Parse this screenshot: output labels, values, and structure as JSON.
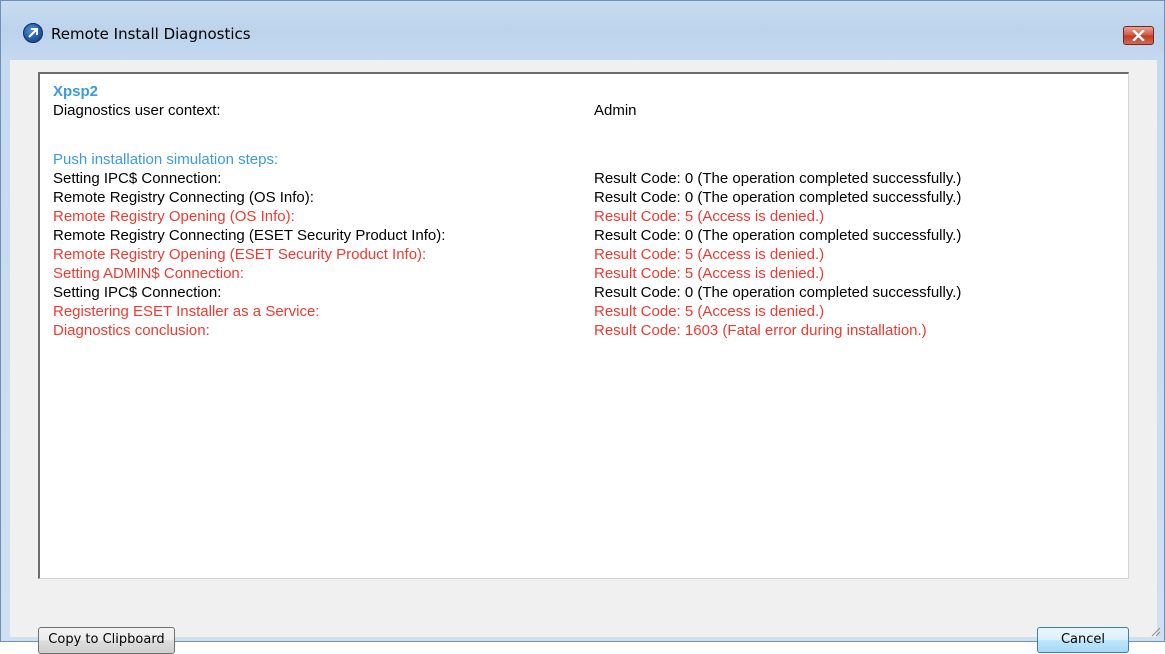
{
  "window": {
    "title": "Remote Install Diagnostics"
  },
  "log": {
    "host": "Xpsp2",
    "context_label": "Diagnostics user context:",
    "context_value": "Admin",
    "steps_heading": "Push installation simulation steps:",
    "steps": [
      {
        "label": "Setting IPC$ Connection:",
        "result": "Result Code: 0 (The operation completed successfully.)",
        "status": "ok"
      },
      {
        "label": "Remote Registry Connecting (OS Info):",
        "result": "Result Code: 0 (The operation completed successfully.)",
        "status": "ok"
      },
      {
        "label": "Remote Registry Opening (OS Info):",
        "result": "Result Code: 5 (Access is denied.)",
        "status": "error"
      },
      {
        "label": "Remote Registry Connecting (ESET Security Product Info):",
        "result": "Result Code: 0 (The operation completed successfully.)",
        "status": "ok"
      },
      {
        "label": "Remote Registry Opening (ESET Security Product Info):",
        "result": "Result Code: 5 (Access is denied.)",
        "status": "error"
      },
      {
        "label": "Setting ADMIN$ Connection:",
        "result": "Result Code: 5 (Access is denied.)",
        "status": "error"
      },
      {
        "label": "Setting IPC$ Connection:",
        "result": "Result Code: 0 (The operation completed successfully.)",
        "status": "ok"
      },
      {
        "label": "Registering ESET Installer as a Service:",
        "result": "Result Code: 5 (Access is denied.)",
        "status": "error"
      },
      {
        "label": "Diagnostics conclusion:",
        "result": "Result Code: 1603 (Fatal error during installation.)",
        "status": "error"
      }
    ]
  },
  "buttons": {
    "copy_label": "Copy to Clipboard",
    "cancel_label": "Cancel"
  },
  "colors": {
    "ok_text": "#000000",
    "error_text": "#ee3a30",
    "accent_blue": "#3c9bdc"
  },
  "icons": {
    "app": "remote-install-icon",
    "close": "close-icon",
    "grip": "resize-grip-icon"
  }
}
